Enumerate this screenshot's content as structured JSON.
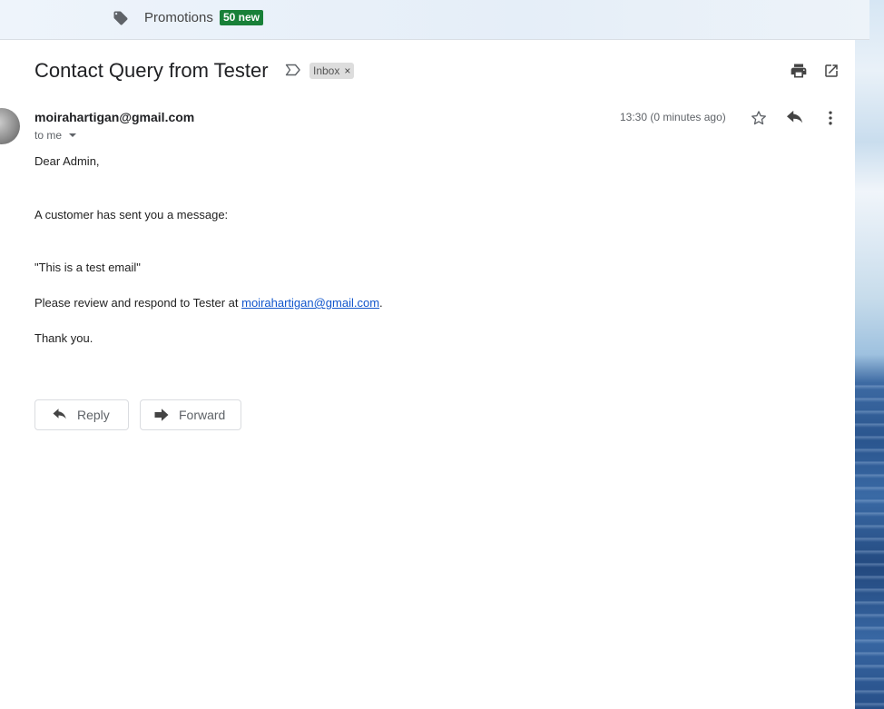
{
  "promotions": {
    "label": "Promotions",
    "badge": "50 new",
    "icon": "tag-icon"
  },
  "email": {
    "subject": "Contact Query from Tester",
    "label_chip": "Inbox",
    "label_chip_close": "×",
    "sender": "moirahartigan@gmail.com",
    "recipient": "to me",
    "time": "13:30 (0 minutes ago)",
    "body": {
      "greeting": "Dear Admin,",
      "intro": "A customer has sent you a message:",
      "quote": "\"This is a test email\"",
      "review_prefix": "Please review and respond to Tester at ",
      "review_email": "moirahartigan@gmail.com",
      "review_suffix": ".",
      "closing": "Thank you."
    }
  },
  "actions": {
    "reply_label": "Reply",
    "forward_label": "Forward"
  },
  "icons": {
    "important": "important-marker-icon",
    "print": "print-icon",
    "popout": "open-in-new-window-icon",
    "star": "star-icon",
    "reply": "reply-icon",
    "more": "more-vertical-icon"
  },
  "colors": {
    "badge_green": "#188038",
    "link_blue": "#1155cc",
    "chip_gray": "#dddddd"
  }
}
